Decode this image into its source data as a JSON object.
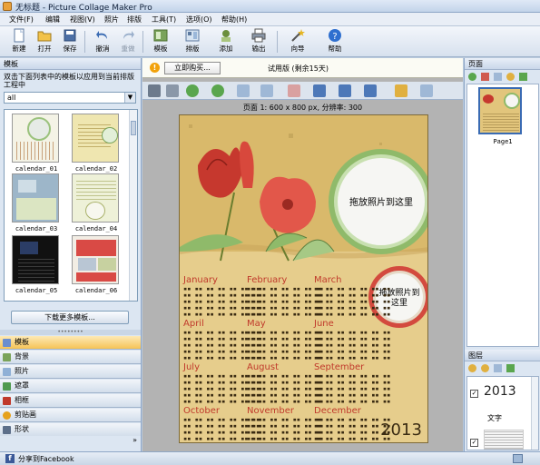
{
  "window": {
    "title": "无标题 - Picture Collage Maker Pro"
  },
  "menu": [
    "文件(F)",
    "编辑",
    "视图(V)",
    "照片",
    "排版",
    "工具(T)",
    "选项(O)",
    "帮助(H)"
  ],
  "toolbar": {
    "new": "新建",
    "open": "打开",
    "save": "保存",
    "undo": "撤消",
    "redo": "重做",
    "template": "模板",
    "layout": "排版",
    "add": "添加",
    "output": "输出",
    "wizard": "向导",
    "help": "帮助"
  },
  "left_panel": {
    "title": "模板",
    "description": "双击下面列表中的模板以应用到当前排版工程中",
    "filter_value": "all",
    "templates": [
      "calendar_01",
      "calendar_02",
      "calendar_03",
      "calendar_04",
      "calendar_05",
      "calendar_06"
    ],
    "download_button": "下载更多模板...",
    "nav": [
      "模板",
      "背景",
      "照片",
      "遮罩",
      "相框",
      "剪贴画",
      "形状"
    ],
    "more": "»"
  },
  "center": {
    "buy_button": "立即购买...",
    "trial_text": "试用版 (剩余15天)",
    "page_info": "页面 1: 600 x 800 px, 分辨率: 300",
    "photo_placeholder_1": "拖放照片到这里",
    "photo_placeholder_2_line1": "拖放照片到",
    "photo_placeholder_2_line2": "这里",
    "months": [
      "January",
      "February",
      "March",
      "April",
      "May",
      "June",
      "July",
      "August",
      "September",
      "October",
      "November",
      "December"
    ],
    "year": "2013"
  },
  "right_panel": {
    "pages_title": "页面",
    "page_label": "Page1",
    "layers_title": "图层",
    "layer1": "2013",
    "layer2": "文字"
  },
  "statusbar": {
    "share": "分享到Facebook"
  },
  "colors": {
    "accent": "#f6c356",
    "canvas": "#e2c57c",
    "calendar_text": "#c0392b",
    "leaf": "#8fba6a"
  }
}
